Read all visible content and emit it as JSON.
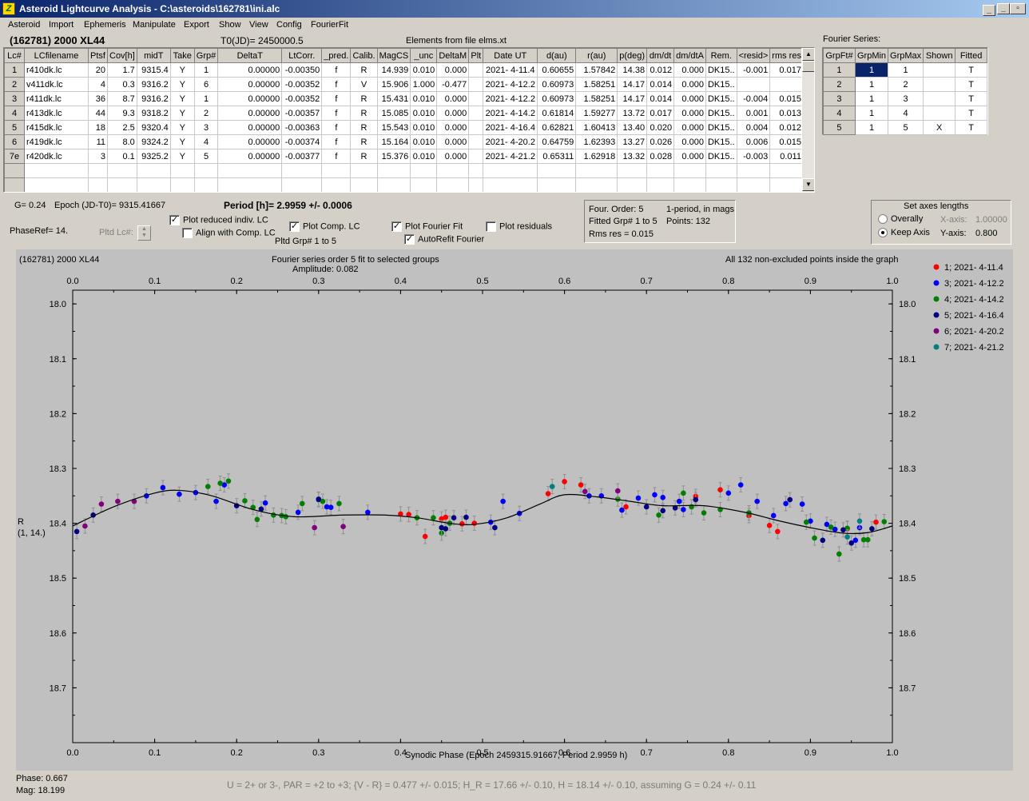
{
  "window": {
    "title": "Asteroid Lightcurve Analysis - C:\\asteroids\\162781\\ini.alc",
    "app_icon": "Z"
  },
  "menu": [
    "Asteroid",
    "Import",
    "Ephemeris",
    "Manipulate",
    "Export",
    "Show",
    "View",
    "Config",
    "FourierFit"
  ],
  "header": {
    "asteroid": "(162781) 2000 XL44",
    "t0": "T0(JD)= 2450000.5",
    "elements": "Elements from file elms.xt",
    "fourier_series_label": "Fourier Series:"
  },
  "lc_table": {
    "columns": [
      "Lc#",
      "LCfilename",
      "Ptsf",
      "Cov[h]",
      "midT",
      "Take",
      "Grp#",
      "DeltaT",
      "LtCorr.",
      "_pred.",
      "Calib.",
      "MagCS",
      "_unc",
      "DeltaM",
      "Plt",
      "Date UT",
      "d(au)",
      "r(au)",
      "p(deg)",
      "dm/dt",
      "dm/dtA",
      "Rem.",
      "<resid>",
      "rms res"
    ],
    "rows": [
      [
        "1",
        "r410dk.lc",
        "20",
        "1.7",
        "9315.4",
        "Y",
        "1",
        "0.00000",
        "-0.00350",
        "f",
        "R",
        "14.939",
        "0.010",
        "0.000",
        "",
        "2021- 4-11.4",
        "0.60655",
        "1.57842",
        "14.38",
        "0.012",
        "0.000",
        "DK15..",
        "-0.001",
        "0.017"
      ],
      [
        "2",
        "v411dk.lc",
        "4",
        "0.3",
        "9316.2",
        "Y",
        "6",
        "0.00000",
        "-0.00352",
        "f",
        "V",
        "15.906",
        "1.000",
        "-0.477",
        "",
        "2021- 4-12.2",
        "0.60973",
        "1.58251",
        "14.17",
        "0.014",
        "0.000",
        "DK15..",
        "",
        ""
      ],
      [
        "3",
        "r411dk.lc",
        "36",
        "8.7",
        "9316.2",
        "Y",
        "1",
        "0.00000",
        "-0.00352",
        "f",
        "R",
        "15.431",
        "0.010",
        "0.000",
        "",
        "2021- 4-12.2",
        "0.60973",
        "1.58251",
        "14.17",
        "0.014",
        "0.000",
        "DK15..",
        "-0.004",
        "0.015"
      ],
      [
        "4",
        "r413dk.lc",
        "44",
        "9.3",
        "9318.2",
        "Y",
        "2",
        "0.00000",
        "-0.00357",
        "f",
        "R",
        "15.085",
        "0.010",
        "0.000",
        "",
        "2021- 4-14.2",
        "0.61814",
        "1.59277",
        "13.72",
        "0.017",
        "0.000",
        "DK15..",
        "0.001",
        "0.013"
      ],
      [
        "5",
        "r415dk.lc",
        "18",
        "2.5",
        "9320.4",
        "Y",
        "3",
        "0.00000",
        "-0.00363",
        "f",
        "R",
        "15.543",
        "0.010",
        "0.000",
        "",
        "2021- 4-16.4",
        "0.62821",
        "1.60413",
        "13.40",
        "0.020",
        "0.000",
        "DK15..",
        "0.004",
        "0.012"
      ],
      [
        "6",
        "r419dk.lc",
        "11",
        "8.0",
        "9324.2",
        "Y",
        "4",
        "0.00000",
        "-0.00374",
        "f",
        "R",
        "15.164",
        "0.010",
        "0.000",
        "",
        "2021- 4-20.2",
        "0.64759",
        "1.62393",
        "13.27",
        "0.026",
        "0.000",
        "DK15..",
        "0.006",
        "0.015"
      ],
      [
        "7e",
        "r420dk.lc",
        "3",
        "0.1",
        "9325.2",
        "Y",
        "5",
        "0.00000",
        "-0.00377",
        "f",
        "R",
        "15.376",
        "0.010",
        "0.000",
        "",
        "2021- 4-21.2",
        "0.65311",
        "1.62918",
        "13.32",
        "0.028",
        "0.000",
        "DK15..",
        "-0.003",
        "0.011"
      ]
    ]
  },
  "fourier_table": {
    "columns": [
      "GrpFt#",
      "GrpMin",
      "GrpMax",
      "Shown",
      "Fitted"
    ],
    "rows": [
      [
        "1",
        "1",
        "1",
        "",
        "T"
      ],
      [
        "2",
        "1",
        "2",
        "",
        "T"
      ],
      [
        "3",
        "1",
        "3",
        "",
        "T"
      ],
      [
        "4",
        "1",
        "4",
        "",
        "T"
      ],
      [
        "5",
        "1",
        "5",
        "X",
        "T"
      ]
    ]
  },
  "controls": {
    "g_value": "G= 0.24",
    "epoch": "Epoch (JD-T0)= 9315.41667",
    "period": "Period [h]= 2.9959 +/- 0.0006",
    "phase_ref": "PhaseRef= 14.",
    "pltd_lc": "Pltd Lc#:",
    "plot_reduced": "Plot reduced indiv. LC",
    "align_comp": "Align with Comp. LC",
    "plot_comp": "Plot Comp. LC",
    "pltd_grp": "Pltd Grp#  1   to   5",
    "plot_fourier": "Plot Fourier Fit",
    "autorefit": "AutoRefit Fourier",
    "plot_residuals": "Plot residuals",
    "four_order": "Four. Order:  5",
    "one_period": "1-period, in mags",
    "fitted_grp": "Fitted Grp# 1 to 5",
    "points": "Points: 132",
    "rms_res": "Rms res      = 0.015",
    "axes_title": "Set axes lengths",
    "overally": "Overally",
    "keep_axis": "Keep Axis",
    "xaxis_label": "X-axis:",
    "xaxis_value": "1.00000",
    "yaxis_label": "Y-axis:",
    "yaxis_value": "0.800"
  },
  "chart_data": {
    "type": "scatter",
    "title": "Fourier series order 5 fit to selected groups",
    "subtitle": "Amplitude: 0.082",
    "object_label": "(162781) 2000 XL44",
    "note": "All 132 non-excluded points inside the graph",
    "xlabel": "Synodic Phase (Epoch 2459315.91667, Period 2.9959 h)",
    "ylabel": "R",
    "ylabel2": "(1, 14.)",
    "xlim": [
      0,
      1
    ],
    "ylim": [
      18.0,
      18.8
    ],
    "y_inverted": true,
    "xticks": [
      "0.0",
      "0.1",
      "0.2",
      "0.3",
      "0.4",
      "0.5",
      "0.6",
      "0.7",
      "0.8",
      "0.9",
      "1.0"
    ],
    "yticks": [
      "18.0",
      "18.1",
      "18.2",
      "18.3",
      "18.4",
      "18.5",
      "18.6",
      "18.7"
    ],
    "fit": [
      [
        0,
        18.405
      ],
      [
        0.05,
        18.37
      ],
      [
        0.1,
        18.345
      ],
      [
        0.13,
        18.34
      ],
      [
        0.17,
        18.35
      ],
      [
        0.22,
        18.375
      ],
      [
        0.27,
        18.388
      ],
      [
        0.33,
        18.385
      ],
      [
        0.38,
        18.385
      ],
      [
        0.42,
        18.39
      ],
      [
        0.46,
        18.4
      ],
      [
        0.49,
        18.402
      ],
      [
        0.53,
        18.39
      ],
      [
        0.57,
        18.365
      ],
      [
        0.6,
        18.348
      ],
      [
        0.64,
        18.352
      ],
      [
        0.68,
        18.36
      ],
      [
        0.72,
        18.368
      ],
      [
        0.77,
        18.368
      ],
      [
        0.82,
        18.38
      ],
      [
        0.86,
        18.395
      ],
      [
        0.9,
        18.408
      ],
      [
        0.94,
        18.418
      ],
      [
        0.97,
        18.417
      ],
      [
        1.0,
        18.405
      ]
    ],
    "series": [
      {
        "name": "1; 2021- 4-11.4",
        "color": "#ff0000",
        "points": [
          [
            0.4,
            18.383
          ],
          [
            0.41,
            18.384
          ],
          [
            0.45,
            18.392
          ],
          [
            0.43,
            18.424
          ],
          [
            0.455,
            18.389
          ],
          [
            0.475,
            18.401
          ],
          [
            0.49,
            18.4
          ],
          [
            0.58,
            18.346
          ],
          [
            0.6,
            18.324
          ],
          [
            0.62,
            18.33
          ],
          [
            0.675,
            18.37
          ],
          [
            0.76,
            18.351
          ],
          [
            0.79,
            18.339
          ],
          [
            0.825,
            18.386
          ],
          [
            0.85,
            18.404
          ],
          [
            0.86,
            18.415
          ],
          [
            0.945,
            18.41
          ],
          [
            0.98,
            18.398
          ]
        ]
      },
      {
        "name": "3; 2021- 4-12.2",
        "color": "#0000ff",
        "points": [
          [
            0.09,
            18.35
          ],
          [
            0.11,
            18.335
          ],
          [
            0.13,
            18.347
          ],
          [
            0.15,
            18.344
          ],
          [
            0.175,
            18.36
          ],
          [
            0.185,
            18.33
          ],
          [
            0.235,
            18.363
          ],
          [
            0.275,
            18.38
          ],
          [
            0.3,
            18.357
          ],
          [
            0.31,
            18.37
          ],
          [
            0.315,
            18.371
          ],
          [
            0.36,
            18.38
          ],
          [
            0.51,
            18.398
          ],
          [
            0.525,
            18.36
          ],
          [
            0.545,
            18.382
          ],
          [
            0.63,
            18.35
          ],
          [
            0.645,
            18.35
          ],
          [
            0.67,
            18.376
          ],
          [
            0.69,
            18.354
          ],
          [
            0.71,
            18.348
          ],
          [
            0.72,
            18.353
          ],
          [
            0.74,
            18.36
          ],
          [
            0.745,
            18.375
          ],
          [
            0.8,
            18.345
          ],
          [
            0.815,
            18.33
          ],
          [
            0.835,
            18.36
          ],
          [
            0.855,
            18.386
          ],
          [
            0.87,
            18.364
          ],
          [
            0.89,
            18.365
          ],
          [
            0.9,
            18.396
          ],
          [
            0.92,
            18.402
          ],
          [
            0.93,
            18.411
          ],
          [
            0.955,
            18.431
          ],
          [
            0.96,
            18.408
          ]
        ]
      },
      {
        "name": "4; 2021- 4-14.2",
        "color": "#008000",
        "points": [
          [
            0.165,
            18.333
          ],
          [
            0.18,
            18.327
          ],
          [
            0.19,
            18.323
          ],
          [
            0.21,
            18.359
          ],
          [
            0.22,
            18.371
          ],
          [
            0.225,
            18.393
          ],
          [
            0.245,
            18.385
          ],
          [
            0.255,
            18.386
          ],
          [
            0.26,
            18.388
          ],
          [
            0.28,
            18.364
          ],
          [
            0.305,
            18.36
          ],
          [
            0.325,
            18.364
          ],
          [
            0.42,
            18.39
          ],
          [
            0.44,
            18.39
          ],
          [
            0.45,
            18.418
          ],
          [
            0.46,
            18.4
          ],
          [
            0.665,
            18.356
          ],
          [
            0.715,
            18.385
          ],
          [
            0.745,
            18.345
          ],
          [
            0.755,
            18.37
          ],
          [
            0.77,
            18.381
          ],
          [
            0.79,
            18.375
          ],
          [
            0.825,
            18.381
          ],
          [
            0.895,
            18.398
          ],
          [
            0.905,
            18.427
          ],
          [
            0.925,
            18.407
          ],
          [
            0.935,
            18.456
          ],
          [
            0.945,
            18.409
          ],
          [
            0.965,
            18.43
          ],
          [
            0.97,
            18.43
          ],
          [
            0.99,
            18.397
          ]
        ]
      },
      {
        "name": "5; 2021- 4-16.4",
        "color": "#000080",
        "points": [
          [
            0.005,
            18.415
          ],
          [
            0.025,
            18.385
          ],
          [
            0.2,
            18.368
          ],
          [
            0.23,
            18.374
          ],
          [
            0.3,
            18.356
          ],
          [
            0.45,
            18.408
          ],
          [
            0.455,
            18.41
          ],
          [
            0.465,
            18.39
          ],
          [
            0.48,
            18.389
          ],
          [
            0.515,
            18.408
          ],
          [
            0.7,
            18.37
          ],
          [
            0.72,
            18.377
          ],
          [
            0.735,
            18.372
          ],
          [
            0.76,
            18.357
          ],
          [
            0.875,
            18.357
          ],
          [
            0.915,
            18.431
          ],
          [
            0.94,
            18.412
          ],
          [
            0.95,
            18.436
          ],
          [
            0.975,
            18.41
          ]
        ]
      },
      {
        "name": "6; 2021- 4-20.2",
        "color": "#800080",
        "points": [
          [
            0.015,
            18.405
          ],
          [
            0.035,
            18.365
          ],
          [
            0.055,
            18.36
          ],
          [
            0.075,
            18.36
          ],
          [
            0.295,
            18.408
          ],
          [
            0.33,
            18.406
          ],
          [
            0.625,
            18.342
          ],
          [
            0.665,
            18.341
          ]
        ]
      },
      {
        "name": "7; 2021- 4-21.2",
        "color": "#008080",
        "points": [
          [
            0.585,
            18.333
          ],
          [
            0.945,
            18.425
          ],
          [
            0.96,
            18.396
          ]
        ]
      }
    ]
  },
  "footer": {
    "phase": "Phase:  0.667",
    "mag": "Mag:   18.199",
    "summary": "U = 2+ or 3-, PAR = +2 to +3; {V - R} = 0.477 +/- 0.015; H_R = 17.66 +/- 0.10, H = 18.14 +/- 0.10, assuming G = 0.24 +/- 0.11"
  }
}
